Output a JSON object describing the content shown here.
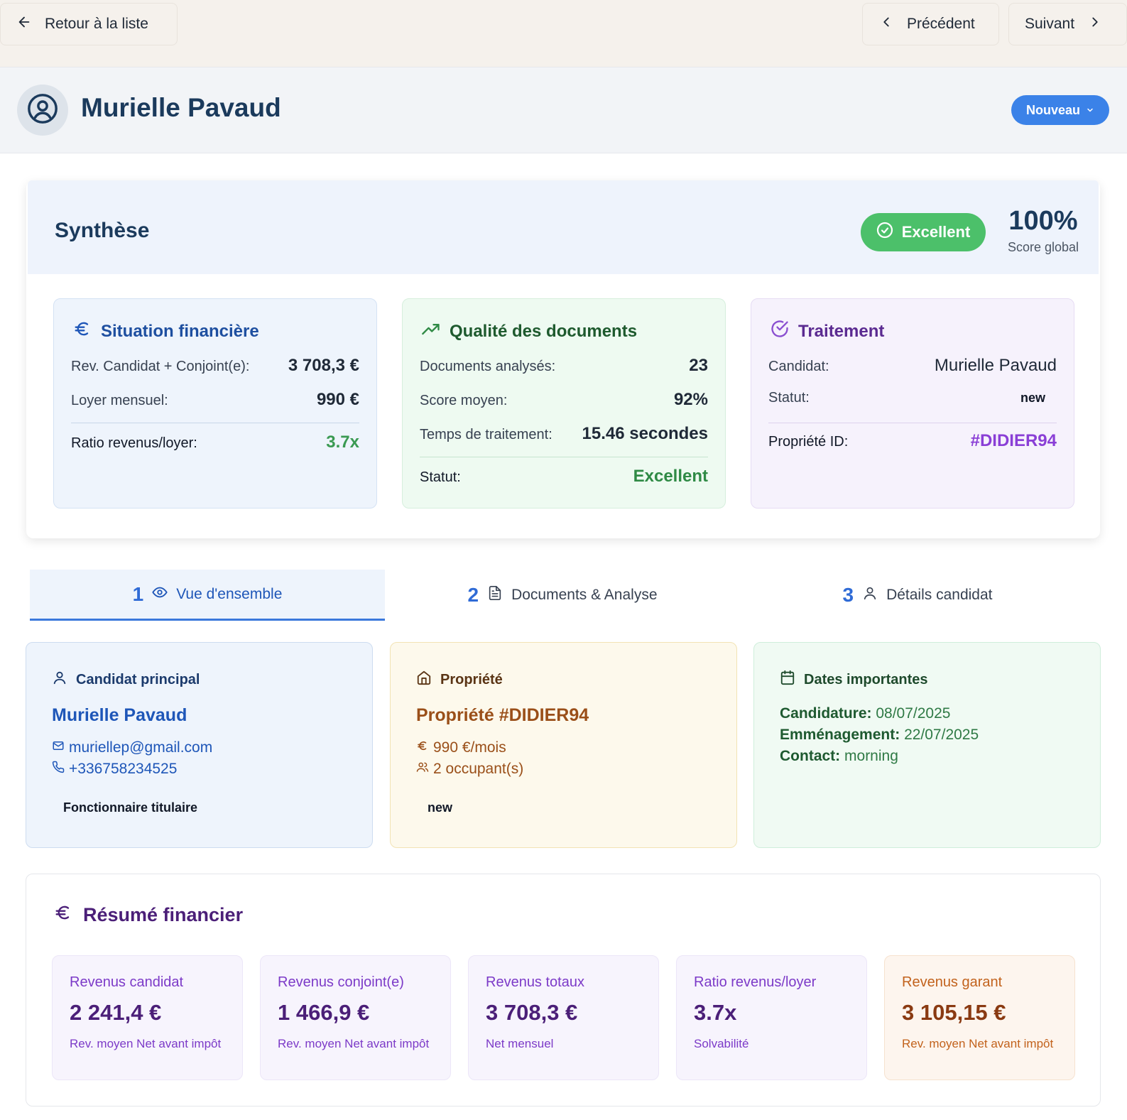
{
  "nav": {
    "back_label": "Retour à la liste",
    "prev_label": "Précédent",
    "next_label": "Suivant"
  },
  "header": {
    "name": "Murielle Pavaud",
    "status": "Nouveau"
  },
  "synthese": {
    "title": "Synthèse",
    "badge": "Excellent",
    "score": "100%",
    "score_label": "Score global",
    "financial": {
      "title": "Situation financière",
      "rows": [
        {
          "label": "Rev. Candidat + Conjoint(e):",
          "value": "3 708,3 €"
        },
        {
          "label": "Loyer mensuel:",
          "value": "990 €"
        }
      ],
      "ratio_label": "Ratio revenus/loyer:",
      "ratio_value": "3.7x"
    },
    "documents": {
      "title": "Qualité des documents",
      "rows": [
        {
          "label": "Documents analysés:",
          "value": "23"
        },
        {
          "label": "Score moyen:",
          "value": "92%"
        },
        {
          "label": "Temps de traitement:",
          "value": "15.46 secondes"
        }
      ],
      "status_label": "Statut:",
      "status_value": "Excellent"
    },
    "processing": {
      "title": "Traitement",
      "candidate_label": "Candidat:",
      "candidate_value": "Murielle Pavaud",
      "status_label": "Statut:",
      "status_value": "new",
      "property_label": "Propriété ID:",
      "property_value": "#DIDIER94"
    }
  },
  "tabs": [
    {
      "num": "1",
      "label": "Vue d'ensemble",
      "icon": "eye-icon"
    },
    {
      "num": "2",
      "label": "Documents & Analyse",
      "icon": "file-icon"
    },
    {
      "num": "3",
      "label": "Détails candidat",
      "icon": "user-icon"
    }
  ],
  "overview": {
    "candidate": {
      "title": "Candidat principal",
      "name": "Murielle Pavaud",
      "email": "muriellep@gmail.com",
      "phone": "+336758234525",
      "tag": "Fonctionnaire titulaire"
    },
    "property": {
      "title": "Propriété",
      "name": "Propriété #DIDIER94",
      "rent": "990 €/mois",
      "occupants": "2 occupant(s)",
      "tag": "new"
    },
    "dates": {
      "title": "Dates importantes",
      "application_label": "Candidature:",
      "application_value": "08/07/2025",
      "move_label": "Emménagement:",
      "move_value": "22/07/2025",
      "contact_label": "Contact:",
      "contact_value": "morning"
    }
  },
  "financial_summary": {
    "title": "Résumé financier",
    "boxes": [
      {
        "label": "Revenus candidat",
        "value": "2 241,4 €",
        "sub": "Rev. moyen Net avant impôt"
      },
      {
        "label": "Revenus conjoint(e)",
        "value": "1 466,9 €",
        "sub": "Rev. moyen Net avant impôt"
      },
      {
        "label": "Revenus totaux",
        "value": "3 708,3 €",
        "sub": "Net mensuel"
      },
      {
        "label": "Ratio revenus/loyer",
        "value": "3.7x",
        "sub": "Solvabilité"
      },
      {
        "label": "Revenus garant",
        "value": "3 105,15 €",
        "sub": "Rev. moyen Net avant impôt"
      }
    ]
  },
  "colors": {
    "primary": "#3b82e8",
    "success": "#4cc06a",
    "purple": "#7c3ac8",
    "orange": "#c2621c"
  }
}
